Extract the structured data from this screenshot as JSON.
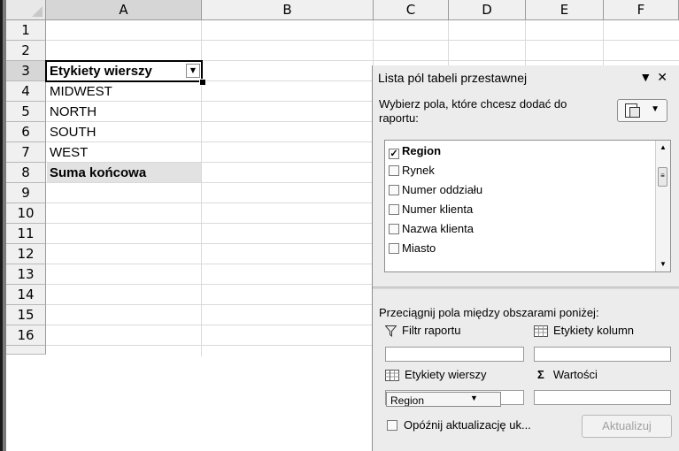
{
  "columns": [
    "A",
    "B",
    "C",
    "D",
    "E",
    "F"
  ],
  "rows": [
    "1",
    "2",
    "3",
    "4",
    "5",
    "6",
    "7",
    "8",
    "9",
    "10",
    "11",
    "12",
    "13",
    "14",
    "15",
    "16"
  ],
  "cells": {
    "a3": "Etykiety wierszy",
    "a4": "MIDWEST",
    "a5": "NORTH",
    "a6": "SOUTH",
    "a7": "WEST",
    "a8": "Suma końcowa"
  },
  "pivot_panel": {
    "title": "Lista pól tabeli przestawnej",
    "description": "Wybierz pola, które chcesz dodać do raportu:",
    "fields": [
      {
        "label": "Region",
        "checked": true
      },
      {
        "label": "Rynek",
        "checked": false
      },
      {
        "label": "Numer oddziału",
        "checked": false
      },
      {
        "label": "Numer klienta",
        "checked": false
      },
      {
        "label": "Nazwa klienta",
        "checked": false
      },
      {
        "label": "Miasto",
        "checked": false
      }
    ],
    "drag_instruction": "Przeciągnij pola między obszarami poniżej:",
    "areas": {
      "filter": "Filtr raportu",
      "column_labels": "Etykiety kolumn",
      "row_labels": "Etykiety wierszy",
      "values": "Wartości"
    },
    "row_field_chip": "Region",
    "defer_label": "Opóźnij aktualizację uk...",
    "update_button": "Aktualizuj"
  },
  "colors": {
    "header_bg": "#f0f0f0",
    "selected_header_bg": "#d6d6d6",
    "panel_bg": "#ececec"
  }
}
